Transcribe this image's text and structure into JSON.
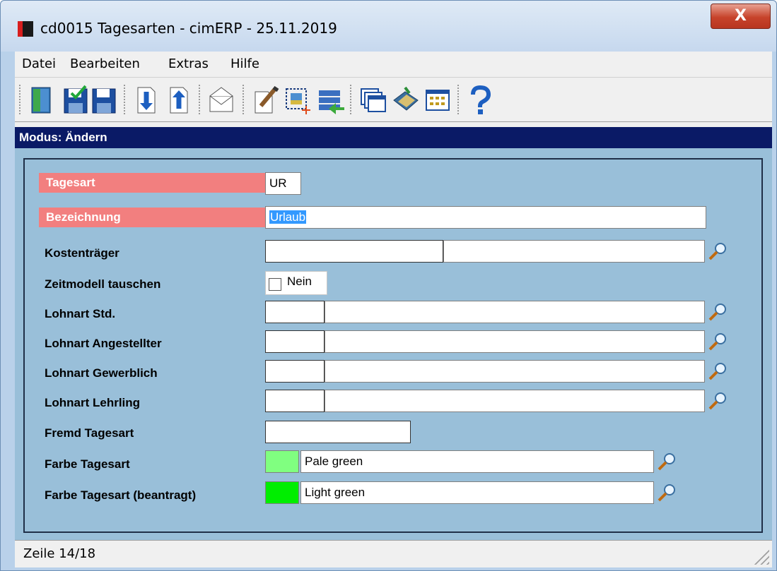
{
  "window": {
    "title": "cd0015 Tagesarten - cimERP - 25.11.2019",
    "close_label": "X"
  },
  "menu": [
    "Datei",
    "Bearbeiten",
    "Extras",
    "Hilfe"
  ],
  "toolbar_icons": [
    "exit-icon",
    "save-close-icon",
    "save-icon",
    "next-record-icon",
    "previous-record-icon",
    "mail-icon",
    "edit-icon",
    "select-new-icon",
    "list-transfer-icon",
    "windows-icon",
    "book-icon",
    "grid-icon",
    "help-icon"
  ],
  "mode": {
    "text": "Modus: Ändern"
  },
  "form": {
    "tagesart": {
      "label": "Tagesart",
      "value": "UR"
    },
    "bezeichnung": {
      "label": "Bezeichnung",
      "value": "Urlaub"
    },
    "kostentraeger": {
      "label": "Kostenträger",
      "code": "",
      "desc": ""
    },
    "zeitmodell": {
      "label": "Zeitmodell tauschen",
      "checkbox_label": "Nein",
      "checked": false
    },
    "lohnart_std": {
      "label": "Lohnart Std.",
      "code": "",
      "desc": ""
    },
    "lohnart_angestellter": {
      "label": "Lohnart Angestellter",
      "code": "",
      "desc": ""
    },
    "lohnart_gewerblich": {
      "label": "Lohnart Gewerblich",
      "code": "",
      "desc": ""
    },
    "lohnart_lehrling": {
      "label": "Lohnart Lehrling",
      "code": "",
      "desc": ""
    },
    "fremd_tagesart": {
      "label": "Fremd Tagesart",
      "value": ""
    },
    "farbe_tagesart": {
      "label": "Farbe Tagesart",
      "color": "#80ff80",
      "value": "Pale green"
    },
    "farbe_beantragt": {
      "label": "Farbe Tagesart (beantragt)",
      "color": "#00ee00",
      "value": "Light green"
    }
  },
  "colors": {
    "mode_bar": "#0a1a66",
    "required_label": "#f27f7f",
    "form_bg": "#99bfd9"
  },
  "status": {
    "text": "Zeile 14/18"
  }
}
